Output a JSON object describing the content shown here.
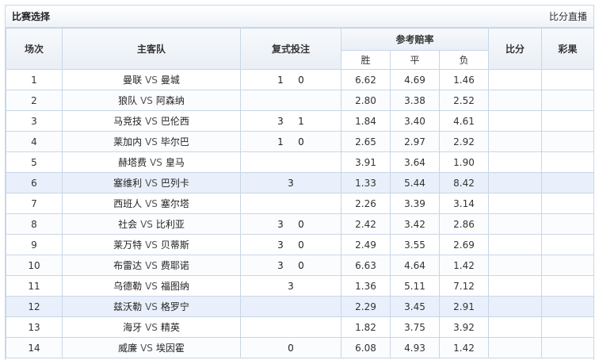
{
  "header": {
    "title": "比赛选择",
    "live_link": "比分直播"
  },
  "columns": {
    "round": "场次",
    "teams": "主客队",
    "compound": "复式投注",
    "odds_group": "参考赔率",
    "win": "胜",
    "draw": "平",
    "lose": "负",
    "score": "比分",
    "result": "彩果"
  },
  "vs_text": "VS",
  "rows": [
    {
      "no": "1",
      "home": "曼联",
      "away": "曼城",
      "picks": [
        "1",
        "0"
      ],
      "win": "6.62",
      "draw": "4.69",
      "lose": "1.46",
      "score": "",
      "result": ""
    },
    {
      "no": "2",
      "home": "狼队",
      "away": "阿森纳",
      "picks": [],
      "win": "2.80",
      "draw": "3.38",
      "lose": "2.52",
      "score": "",
      "result": ""
    },
    {
      "no": "3",
      "home": "马竞技",
      "away": "巴伦西",
      "picks": [
        "3",
        "1"
      ],
      "win": "1.84",
      "draw": "3.40",
      "lose": "4.61",
      "score": "",
      "result": ""
    },
    {
      "no": "4",
      "home": "莱加内",
      "away": "毕尔巴",
      "picks": [
        "1",
        "0"
      ],
      "win": "2.65",
      "draw": "2.97",
      "lose": "2.92",
      "score": "",
      "result": ""
    },
    {
      "no": "5",
      "home": "赫塔费",
      "away": "皇马",
      "picks": [],
      "win": "3.91",
      "draw": "3.64",
      "lose": "1.90",
      "score": "",
      "result": ""
    },
    {
      "no": "6",
      "home": "塞维利",
      "away": "巴列卡",
      "picks": [
        "3"
      ],
      "win": "1.33",
      "draw": "5.44",
      "lose": "8.42",
      "score": "",
      "result": ""
    },
    {
      "no": "7",
      "home": "西班人",
      "away": "塞尔塔",
      "picks": [],
      "win": "2.26",
      "draw": "3.39",
      "lose": "3.14",
      "score": "",
      "result": ""
    },
    {
      "no": "8",
      "home": "社会",
      "away": "比利亚",
      "picks": [
        "3",
        "0"
      ],
      "win": "2.42",
      "draw": "3.42",
      "lose": "2.86",
      "score": "",
      "result": ""
    },
    {
      "no": "9",
      "home": "莱万特",
      "away": "贝蒂斯",
      "picks": [
        "3",
        "0"
      ],
      "win": "2.49",
      "draw": "3.55",
      "lose": "2.69",
      "score": "",
      "result": ""
    },
    {
      "no": "10",
      "home": "布雷达",
      "away": "费耶诺",
      "picks": [
        "3",
        "0"
      ],
      "win": "6.63",
      "draw": "4.64",
      "lose": "1.42",
      "score": "",
      "result": ""
    },
    {
      "no": "11",
      "home": "乌德勒",
      "away": "福图纳",
      "picks": [
        "3"
      ],
      "win": "1.36",
      "draw": "5.11",
      "lose": "7.12",
      "score": "",
      "result": ""
    },
    {
      "no": "12",
      "home": "兹沃勒",
      "away": "格罗宁",
      "picks": [],
      "win": "2.29",
      "draw": "3.45",
      "lose": "2.91",
      "score": "",
      "result": ""
    },
    {
      "no": "13",
      "home": "海牙",
      "away": "精英",
      "picks": [],
      "win": "1.82",
      "draw": "3.75",
      "lose": "3.92",
      "score": "",
      "result": ""
    },
    {
      "no": "14",
      "home": "威廉",
      "away": "埃因霍",
      "picks": [
        "0"
      ],
      "win": "6.08",
      "draw": "4.93",
      "lose": "1.42",
      "score": "",
      "result": ""
    }
  ],
  "highlight_rows": [
    "6",
    "12"
  ]
}
